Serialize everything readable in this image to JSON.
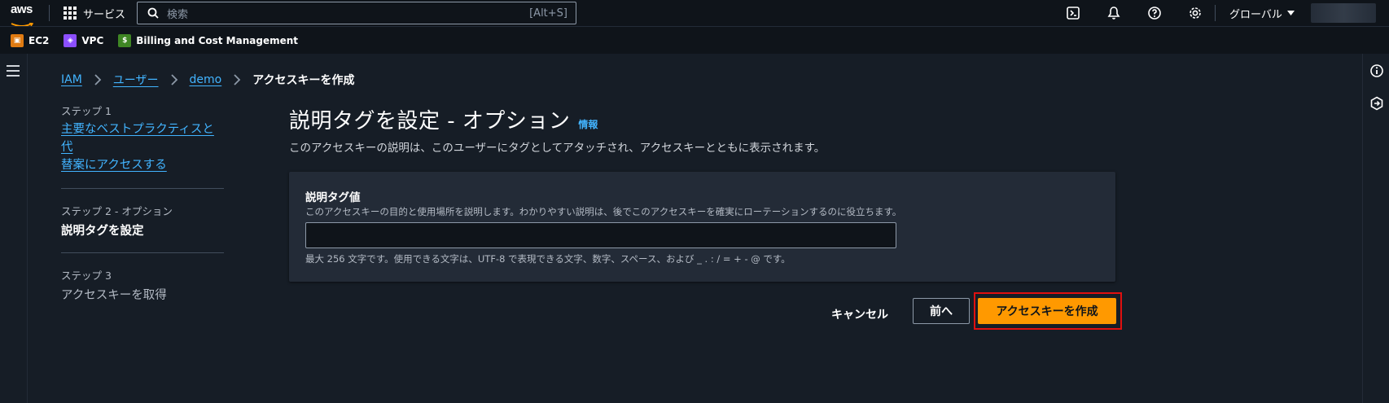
{
  "topnav": {
    "logo_text": "aws",
    "services_label": "サービス",
    "search_placeholder": "検索",
    "search_shortcut": "[Alt+S]",
    "region_label": "グローバル",
    "icons": [
      "cloudshell-icon",
      "notifications-icon",
      "help-icon",
      "settings-icon"
    ]
  },
  "favorites": [
    {
      "label": "EC2",
      "icon": "ec2-icon",
      "color": "#e07b12"
    },
    {
      "label": "VPC",
      "icon": "vpc-icon",
      "color": "#8c4fff"
    },
    {
      "label": "Billing and Cost Management",
      "icon": "billing-icon",
      "color": "#3f8624"
    }
  ],
  "breadcrumb": {
    "items": [
      "IAM",
      "ユーザー",
      "demo"
    ],
    "current": "アクセスキーを作成"
  },
  "steps": [
    {
      "number": "ステップ 1",
      "label_line1": "主要なベストプラクティスと代",
      "label_line2": "替案にアクセスする"
    },
    {
      "number": "ステップ 2 - オプション",
      "label": "説明タグを設定"
    },
    {
      "number": "ステップ 3",
      "label": "アクセスキーを取得"
    }
  ],
  "main": {
    "title": "説明タグを設定 - オプション",
    "info_link": "情報",
    "description": "このアクセスキーの説明は、このユーザーにタグとしてアタッチされ、アクセスキーとともに表示されます。",
    "field": {
      "label": "説明タグ値",
      "description": "このアクセスキーの目的と使用場所を説明します。わかりやすい説明は、後でこのアクセスキーを確実にローテーションするのに役立ちます。",
      "value": "",
      "constraint": "最大 256 文字です。使用できる文字は、UTF-8 で表現できる文字、数字、スペース、および _ . : / = + - @ です。"
    }
  },
  "actions": {
    "cancel": "キャンセル",
    "previous": "前へ",
    "primary": "アクセスキーを作成"
  },
  "colors": {
    "accent_link": "#42b4ff",
    "primary_button": "#ff9900",
    "highlight_box": "#e01010",
    "background": "#161d26",
    "nav_background": "#0f141a"
  }
}
